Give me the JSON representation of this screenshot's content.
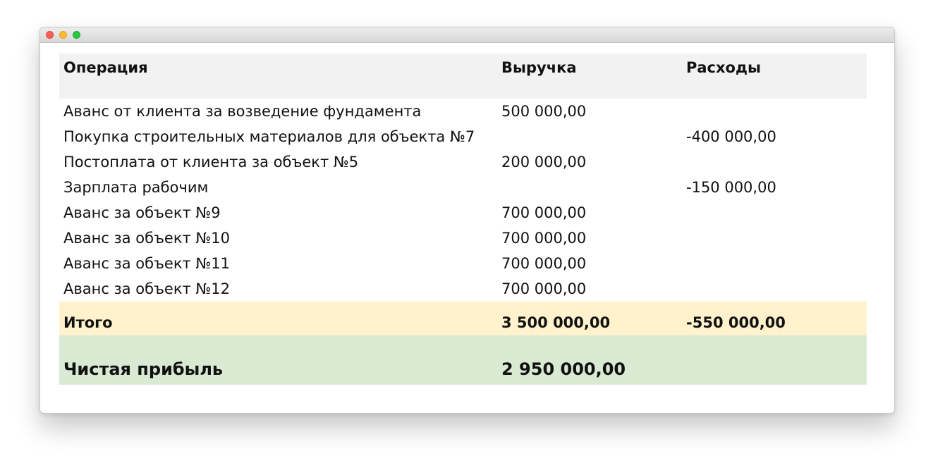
{
  "table": {
    "headers": [
      "Операция",
      "Выручка",
      "Расходы"
    ],
    "rows": [
      {
        "operation": "Аванс от клиента за возведение фундамента",
        "revenue": "500 000,00",
        "expense": ""
      },
      {
        "operation": "Покупка строительных материалов для объекта №7",
        "revenue": "",
        "expense": "-400 000,00"
      },
      {
        "operation": "Постоплата от клиента за объект №5",
        "revenue": "200 000,00",
        "expense": ""
      },
      {
        "operation": "Зарплата рабочим",
        "revenue": "",
        "expense": "-150 000,00"
      },
      {
        "operation": "Аванс за объект №9",
        "revenue": "700 000,00",
        "expense": ""
      },
      {
        "operation": "Аванс за объект №10",
        "revenue": "700 000,00",
        "expense": ""
      },
      {
        "operation": "Аванс за объект №11",
        "revenue": "700 000,00",
        "expense": ""
      },
      {
        "operation": "Аванс за объект №12",
        "revenue": "700 000,00",
        "expense": ""
      }
    ],
    "total": {
      "label": "Итого",
      "revenue": "3 500 000,00",
      "expense": "-550 000,00"
    },
    "profit": {
      "label": "Чистая прибыль",
      "value": "2 950 000,00"
    }
  },
  "colors": {
    "header_bg": "#f2f2f2",
    "total_bg": "#fff2cc",
    "profit_bg": "#d9ead3"
  }
}
